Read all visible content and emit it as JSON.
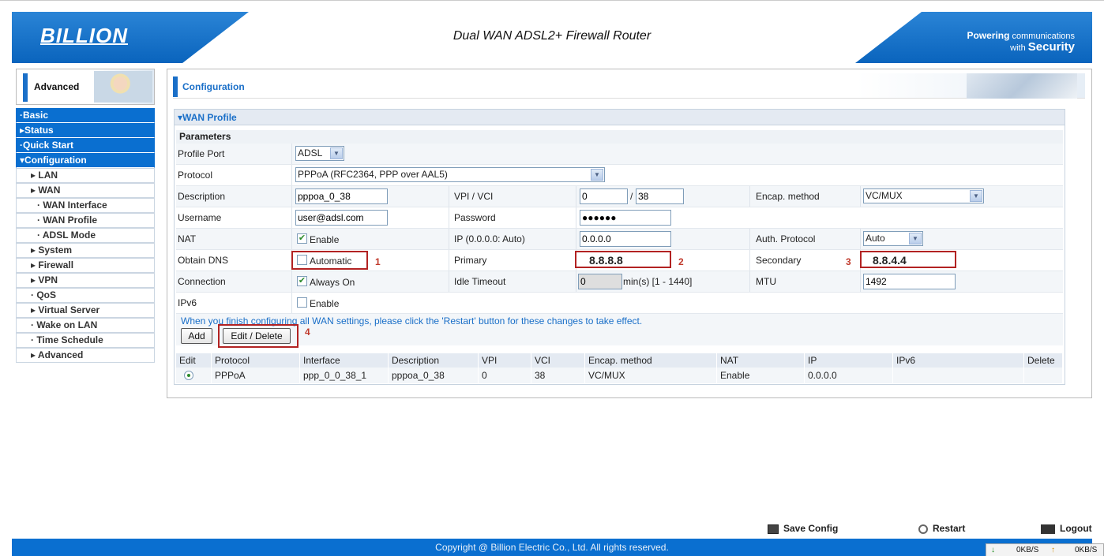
{
  "header": {
    "logo": "BILLION",
    "title": "Dual WAN ADSL2+ Firewall Router",
    "slogan_line1": "Powering",
    "slogan_line1_small": "communications",
    "slogan_line2_small": "with",
    "slogan_line2": "Security"
  },
  "sidebar": {
    "mode_label": "Advanced",
    "items": [
      {
        "label": "Basic",
        "marker": "·"
      },
      {
        "label": "Status",
        "marker": "▸"
      },
      {
        "label": "Quick Start",
        "marker": "·"
      },
      {
        "label": "Configuration",
        "marker": "▾"
      },
      {
        "label": "LAN",
        "marker": "▸"
      },
      {
        "label": "WAN",
        "marker": "▸"
      },
      {
        "label": "WAN Interface",
        "marker": "·"
      },
      {
        "label": "WAN Profile",
        "marker": "·"
      },
      {
        "label": "ADSL Mode",
        "marker": "·"
      },
      {
        "label": "System",
        "marker": "▸"
      },
      {
        "label": "Firewall",
        "marker": "▸"
      },
      {
        "label": "VPN",
        "marker": "▸"
      },
      {
        "label": "QoS",
        "marker": "·"
      },
      {
        "label": "Virtual Server",
        "marker": "▸"
      },
      {
        "label": "Wake on LAN",
        "marker": "·"
      },
      {
        "label": "Time Schedule",
        "marker": "·"
      },
      {
        "label": "Advanced",
        "marker": "▸"
      }
    ]
  },
  "main": {
    "section_title": "Configuration",
    "panel_title": "WAN Profile",
    "panel_marker": "▾",
    "params_title": "Parameters",
    "labels": {
      "profile_port": "Profile Port",
      "protocol": "Protocol",
      "description": "Description",
      "vpi_vci": "VPI / VCI",
      "encap_method": "Encap. method",
      "username": "Username",
      "password": "Password",
      "nat": "NAT",
      "ip": "IP (0.0.0.0: Auto)",
      "auth_protocol": "Auth. Protocol",
      "obtain_dns": "Obtain DNS",
      "primary": "Primary",
      "secondary": "Secondary",
      "connection": "Connection",
      "idle_timeout": "Idle Timeout",
      "mtu": "MTU",
      "ipv6": "IPv6"
    },
    "values": {
      "profile_port": "ADSL",
      "protocol": "PPPoA (RFC2364, PPP over AAL5)",
      "description": "pppoa_0_38",
      "vpi": "0",
      "vci_sep": "/",
      "vci": "38",
      "encap_method": "VC/MUX",
      "username": "user@adsl.com",
      "password": "●●●●●●",
      "nat_label": "Enable",
      "ip": "0.0.0.0",
      "auth_protocol": "Auto",
      "obtain_dns_label": "Automatic",
      "primary_dns": "8.8.8.8",
      "secondary_dns": "8.8.4.4",
      "connection_label": "Always On",
      "idle_timeout": "0",
      "idle_unit": "min(s) [1 - 1440]",
      "mtu": "1492",
      "ipv6_label": "Enable"
    },
    "checks": {
      "nat": "✔",
      "obtain_dns": "",
      "connection": "✔",
      "ipv6": ""
    },
    "annotations": [
      "1",
      "2",
      "3",
      "4"
    ],
    "note": "When you finish configuring all WAN settings, please click the 'Restart' button for these changes to take effect.",
    "buttons": {
      "add": "Add",
      "edit_delete": "Edit / Delete"
    },
    "table": {
      "headers": [
        "Edit",
        "Protocol",
        "Interface",
        "Description",
        "VPI",
        "VCI",
        "Encap. method",
        "NAT",
        "IP",
        "IPv6",
        "Delete"
      ],
      "rows": [
        {
          "protocol": "PPPoA",
          "interface": "ppp_0_0_38_1",
          "description": "pppoa_0_38",
          "vpi": "0",
          "vci": "38",
          "encap": "VC/MUX",
          "nat": "Enable",
          "ip": "0.0.0.0",
          "ipv6": "",
          "delete": ""
        }
      ]
    }
  },
  "footer": {
    "save_config": "Save Config",
    "restart": "Restart",
    "logout": "Logout",
    "copyright": "Copyright @ Billion Electric Co., Ltd. All rights reserved."
  },
  "netspeed": {
    "down_arrow": "↓",
    "down": "0KB/S",
    "up_arrow": "↑",
    "up": "0KB/S"
  },
  "colors": {
    "brand_blue": "#0a6fd0",
    "highlight_red": "#b22222"
  }
}
